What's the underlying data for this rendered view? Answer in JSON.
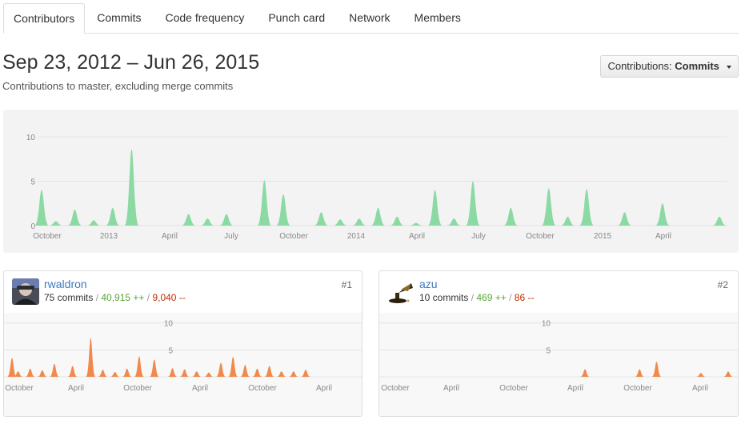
{
  "tabs": [
    {
      "label": "Contributors",
      "active": true
    },
    {
      "label": "Commits"
    },
    {
      "label": "Code frequency"
    },
    {
      "label": "Punch card"
    },
    {
      "label": "Network"
    },
    {
      "label": "Members"
    }
  ],
  "header": {
    "title": "Sep 23, 2012 – Jun 26, 2015",
    "subtitle": "Contributions to master, excluding merge commits"
  },
  "contributions_select": {
    "label": "Contributions:",
    "value": "Commits"
  },
  "colors": {
    "main_area": "#8cdaa3",
    "contributor_area": "#f0894b",
    "link": "#4078c0",
    "additions": "#55a532",
    "deletions": "#bd2c00"
  },
  "chart_data": [
    {
      "type": "area",
      "title": "",
      "y_ticks": [
        "10",
        "5",
        "0"
      ],
      "ylim": [
        0,
        11
      ],
      "x_ticks": [
        "October",
        "2013",
        "April",
        "July",
        "October",
        "2014",
        "April",
        "July",
        "October",
        "2015",
        "April"
      ],
      "grid": true,
      "x": [
        0,
        3,
        7,
        11,
        15,
        19,
        23,
        27,
        31,
        35,
        39,
        43,
        47,
        51,
        55,
        59,
        63,
        67,
        71,
        75,
        79,
        83,
        87,
        91,
        95,
        99,
        103,
        107,
        111,
        115,
        119,
        123,
        127,
        131,
        135,
        139,
        143
      ],
      "values": [
        4,
        0.5,
        1.8,
        0.6,
        2,
        8.6,
        0,
        0,
        1.3,
        0.8,
        1.3,
        0,
        5.1,
        3.5,
        0,
        1.5,
        0.7,
        0.8,
        2,
        1,
        0.3,
        4,
        0.8,
        5,
        0,
        2,
        0,
        4.2,
        1,
        4.1,
        0,
        1.5,
        0,
        2.5,
        0,
        0,
        1
      ],
      "series": [
        {
          "name": "",
          "values": [
            4,
            0.5,
            1.8,
            0.6,
            2,
            8.6,
            0,
            0,
            1.3,
            0.8,
            1.3,
            0,
            5.1,
            3.5,
            0,
            1.5,
            0.7,
            0.8,
            2,
            1,
            0.3,
            4,
            0.8,
            5,
            0,
            2,
            0,
            4.2,
            1,
            4.1,
            0,
            1.5,
            0,
            2.5,
            0,
            0,
            1
          ]
        }
      ]
    },
    {
      "type": "area",
      "title": "",
      "y_ticks": [
        "10",
        "5"
      ],
      "ylim": [
        0,
        11
      ],
      "x_ticks": [
        "October",
        "April",
        "October",
        "April",
        "October",
        "April"
      ],
      "grid": true,
      "x": [
        0,
        2,
        6,
        10,
        14,
        20,
        26,
        30,
        34,
        38,
        42,
        47,
        53,
        57,
        61,
        65,
        69,
        73,
        77,
        81,
        85,
        89,
        93,
        97
      ],
      "values": [
        3.5,
        1,
        1.5,
        1.2,
        2.4,
        2,
        7.2,
        1.3,
        0.9,
        1.5,
        3.8,
        3.2,
        1.6,
        1.4,
        1,
        0.8,
        2.6,
        3.7,
        2.2,
        1.5,
        2,
        1,
        1,
        1.3
      ]
    },
    {
      "type": "area",
      "title": "",
      "y_ticks": [
        "10",
        "5"
      ],
      "ylim": [
        0,
        11
      ],
      "x_ticks": [
        "October",
        "April",
        "October",
        "April",
        "October",
        "April"
      ],
      "grid": true,
      "x": [
        58,
        74,
        79,
        92,
        100
      ],
      "values": [
        1.4,
        1.4,
        2.8,
        0.7,
        1
      ]
    }
  ],
  "contributors": [
    {
      "name": "rwaldron",
      "commits": "75 commits",
      "additions": "40,915 ++",
      "deletions": "9,040 --",
      "rank": "#1"
    },
    {
      "name": "azu",
      "commits": "10 commits",
      "additions": "469 ++",
      "deletions": "86 --",
      "rank": "#2"
    }
  ]
}
